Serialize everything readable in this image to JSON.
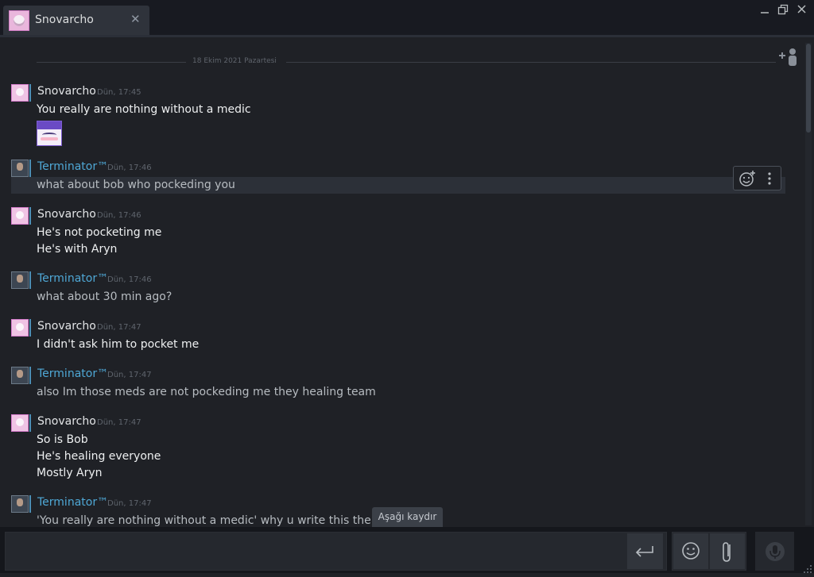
{
  "window": {
    "tab": {
      "label": "Snovarcho"
    }
  },
  "chat": {
    "date_separator": "18 Ekim 2021 Pazartesi",
    "messages": [
      {
        "sender": "Snovarcho",
        "time": "Dün, 17:45",
        "lines": [
          "You really are nothing without a medic"
        ],
        "emote": "purple-hair-emoticon"
      },
      {
        "sender": "Terminator™",
        "time": "Dün, 17:46",
        "lines": [
          "what about bob who pockeding you"
        ]
      },
      {
        "sender": "Snovarcho",
        "time": "Dün, 17:46",
        "lines": [
          "He's not pocketing me",
          "He's with Aryn"
        ]
      },
      {
        "sender": "Terminator™",
        "time": "Dün, 17:46",
        "lines": [
          "what about 30 min ago?"
        ]
      },
      {
        "sender": "Snovarcho",
        "time": "Dün, 17:47",
        "lines": [
          "I didn't ask him to pocket me"
        ]
      },
      {
        "sender": "Terminator™",
        "time": "Dün, 17:47",
        "lines": [
          "also Im those meds are not pockeding me they healing team"
        ]
      },
      {
        "sender": "Snovarcho",
        "time": "Dün, 17:47",
        "lines": [
          "So is Bob",
          "He's healing everyone",
          "Mostly Aryn"
        ]
      },
      {
        "sender": "Terminator™",
        "time": "Dün, 17:47",
        "lines": [
          "'You really are nothing without a medic' why u write this then..."
        ]
      }
    ],
    "scroll_down_label": "Aşağı kaydır"
  },
  "colors": {
    "background": "#1f2126",
    "friend_name": "#4fa8d6",
    "self_name": "#e3e5e7"
  },
  "icons": {
    "send": "enter-icon",
    "emoji": "smiley-icon",
    "attach": "paperclip-icon",
    "voice": "microphone-icon",
    "add_friend": "add-user-icon",
    "reaction": "add-reaction-icon",
    "more": "more-vertical-icon"
  }
}
